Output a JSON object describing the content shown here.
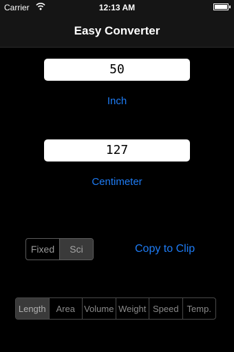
{
  "status_bar": {
    "carrier": "Carrier",
    "time": "12:13 AM",
    "icons": [
      "wifi-icon",
      "battery-icon"
    ]
  },
  "nav": {
    "title": "Easy Converter"
  },
  "converter": {
    "top_value": "50",
    "top_unit": "Inch",
    "bottom_value": "127",
    "bottom_unit": "Centimeter"
  },
  "format_segment": {
    "options": [
      "Fixed",
      "Sci"
    ],
    "selected": "Sci"
  },
  "copy_button": {
    "label": "Copy to Clip"
  },
  "type_segment": {
    "options": [
      "Length",
      "Area",
      "Volume",
      "Weight",
      "Speed",
      "Temp."
    ],
    "selected": "Length"
  },
  "colors": {
    "accent": "#1e7cf5",
    "background": "#000000",
    "bar": "#151515"
  }
}
